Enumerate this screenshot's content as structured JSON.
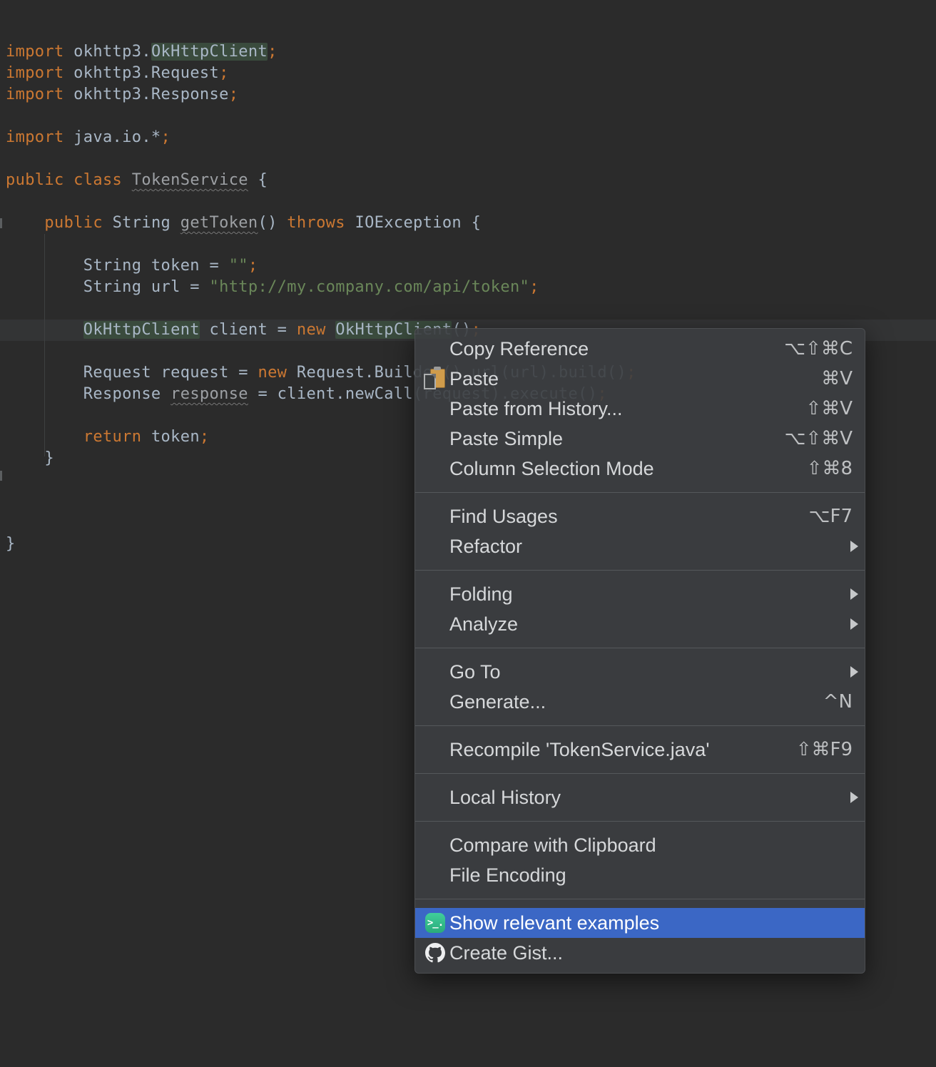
{
  "colors": {
    "editor_background": "#2B2B2B",
    "keyword": "#CC7832",
    "plain_text": "#A9B7C6",
    "string": "#6A8759",
    "declaration_gray": "#9DA0A4",
    "identifier_highlight_bg": "#3A4B3D",
    "current_line_bg": "#333435",
    "menu_background": "#3B3E41",
    "menu_selection": "#3B67C5",
    "menu_label": "#D6D8DA",
    "menu_shortcut": "#BEC0C2",
    "terminal_icon_green": "#31BD87"
  },
  "editor": {
    "current_line": 14,
    "lines": [
      {
        "segments": [
          {
            "text": "import",
            "style": "kw"
          },
          {
            "text": " okhttp3.",
            "style": "plain"
          },
          {
            "text": "OkHttpClient",
            "style": "plain hl"
          },
          {
            "text": ";",
            "style": "kw"
          }
        ]
      },
      {
        "segments": [
          {
            "text": "import",
            "style": "kw"
          },
          {
            "text": " okhttp3.Request",
            "style": "plain"
          },
          {
            "text": ";",
            "style": "kw"
          }
        ]
      },
      {
        "segments": [
          {
            "text": "import",
            "style": "kw"
          },
          {
            "text": " okhttp3.Response",
            "style": "plain"
          },
          {
            "text": ";",
            "style": "kw"
          }
        ]
      },
      {
        "segments": []
      },
      {
        "segments": [
          {
            "text": "import",
            "style": "kw"
          },
          {
            "text": " java.io.*",
            "style": "plain"
          },
          {
            "text": ";",
            "style": "kw"
          }
        ]
      },
      {
        "segments": []
      },
      {
        "segments": [
          {
            "text": "public class ",
            "style": "kw"
          },
          {
            "text": "TokenService",
            "style": "dim wavy"
          },
          {
            "text": " {",
            "style": "plain"
          }
        ]
      },
      {
        "segments": []
      },
      {
        "segments": [
          {
            "text": "    ",
            "style": "plain"
          },
          {
            "text": "public",
            "style": "kw"
          },
          {
            "text": " String ",
            "style": "plain"
          },
          {
            "text": "getToken",
            "style": "dim wavy"
          },
          {
            "text": "() ",
            "style": "plain"
          },
          {
            "text": "throws",
            "style": "kw"
          },
          {
            "text": " IOException {",
            "style": "plain"
          }
        ]
      },
      {
        "segments": []
      },
      {
        "segments": [
          {
            "text": "        String token = ",
            "style": "plain"
          },
          {
            "text": "\"\"",
            "style": "str"
          },
          {
            "text": ";",
            "style": "kw"
          }
        ]
      },
      {
        "segments": [
          {
            "text": "        String url = ",
            "style": "plain"
          },
          {
            "text": "\"http://my.company.com/api/token\"",
            "style": "str"
          },
          {
            "text": ";",
            "style": "kw"
          }
        ]
      },
      {
        "segments": []
      },
      {
        "segments": [
          {
            "text": "        ",
            "style": "plain"
          },
          {
            "text": "OkHttpClient",
            "style": "plain hl"
          },
          {
            "text": " client = ",
            "style": "plain"
          },
          {
            "text": "new",
            "style": "kw"
          },
          {
            "text": " ",
            "style": "plain"
          },
          {
            "text": "OkHttpClient",
            "style": "plain hl"
          },
          {
            "text": "()",
            "style": "plain"
          },
          {
            "text": ";",
            "style": "kw"
          }
        ]
      },
      {
        "segments": []
      },
      {
        "segments": [
          {
            "text": "        Request request = ",
            "style": "plain"
          },
          {
            "text": "new",
            "style": "kw"
          },
          {
            "text": " Request.Builder().url(url).build()",
            "style": "plain"
          },
          {
            "text": ";",
            "style": "kw"
          }
        ]
      },
      {
        "segments": [
          {
            "text": "        Response ",
            "style": "plain"
          },
          {
            "text": "response",
            "style": "dim wavy"
          },
          {
            "text": " = client.newCall(request).execute()",
            "style": "plain"
          },
          {
            "text": ";",
            "style": "kw"
          }
        ]
      },
      {
        "segments": []
      },
      {
        "segments": [
          {
            "text": "        ",
            "style": "plain"
          },
          {
            "text": "return",
            "style": "kw"
          },
          {
            "text": " token",
            "style": "plain"
          },
          {
            "text": ";",
            "style": "kw"
          }
        ]
      },
      {
        "segments": [
          {
            "text": "    }",
            "style": "plain"
          }
        ]
      },
      {
        "segments": []
      },
      {
        "segments": []
      },
      {
        "segments": []
      },
      {
        "segments": [
          {
            "text": "}",
            "style": "plain"
          }
        ]
      }
    ]
  },
  "menu": {
    "icons": {
      "terminal_glyph": ">_."
    },
    "sections": [
      {
        "items": [
          {
            "id": "copy-reference",
            "label": "Copy Reference",
            "shortcut": "⌥⇧⌘C"
          },
          {
            "id": "paste",
            "label": "Paste",
            "shortcut": "⌘V",
            "icon": "clipboard"
          },
          {
            "id": "paste-from-history",
            "label": "Paste from History...",
            "shortcut": "⇧⌘V"
          },
          {
            "id": "paste-simple",
            "label": "Paste Simple",
            "shortcut": "⌥⇧⌘V"
          },
          {
            "id": "column-selection-mode",
            "label": "Column Selection Mode",
            "shortcut": "⇧⌘8"
          }
        ]
      },
      {
        "items": [
          {
            "id": "find-usages",
            "label": "Find Usages",
            "shortcut": "⌥F7"
          },
          {
            "id": "refactor",
            "label": "Refactor",
            "submenu": true
          }
        ]
      },
      {
        "items": [
          {
            "id": "folding",
            "label": "Folding",
            "submenu": true
          },
          {
            "id": "analyze",
            "label": "Analyze",
            "submenu": true
          }
        ]
      },
      {
        "items": [
          {
            "id": "go-to",
            "label": "Go To",
            "submenu": true
          },
          {
            "id": "generate",
            "label": "Generate...",
            "shortcut": "^N"
          }
        ]
      },
      {
        "items": [
          {
            "id": "recompile",
            "label": "Recompile 'TokenService.java'",
            "shortcut": "⇧⌘F9"
          }
        ]
      },
      {
        "items": [
          {
            "id": "local-history",
            "label": "Local History",
            "submenu": true
          }
        ]
      },
      {
        "items": [
          {
            "id": "compare-with-clipboard",
            "label": "Compare with Clipboard"
          },
          {
            "id": "file-encoding",
            "label": "File Encoding"
          }
        ]
      },
      {
        "items": [
          {
            "id": "show-relevant-examples",
            "label": "Show relevant examples",
            "icon": "terminal",
            "selected": true
          },
          {
            "id": "create-gist",
            "label": "Create Gist...",
            "icon": "github"
          }
        ]
      }
    ]
  }
}
